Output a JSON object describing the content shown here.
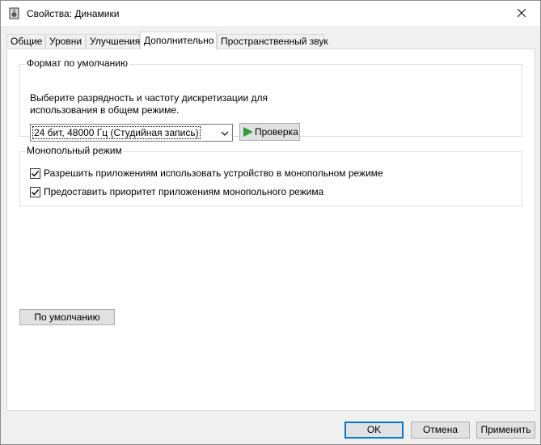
{
  "window": {
    "title": "Свойства: Динамики"
  },
  "tabs": [
    {
      "label": "Общие"
    },
    {
      "label": "Уровни"
    },
    {
      "label": "Улучшения"
    },
    {
      "label": "Дополнительно"
    },
    {
      "label": "Пространственный звук"
    }
  ],
  "active_tab": "Дополнительно",
  "default_format": {
    "title": "Формат по умолчанию",
    "description": "Выберите разрядность и частоту дискретизации для использования в общем режиме.",
    "selected_format": "24 бит, 48000 Гц (Студийная запись)",
    "test_button": "Проверка"
  },
  "exclusive_mode": {
    "title": "Монопольный режим",
    "options": [
      {
        "label": "Разрешить приложениям использовать устройство в монопольном режиме",
        "checked": true
      },
      {
        "label": "Предоставить приоритет приложениям монопольного режима",
        "checked": true
      }
    ]
  },
  "restore_defaults_button": "По умолчанию",
  "buttons": {
    "ok": "OK",
    "cancel": "Отмена",
    "apply": "Применить"
  },
  "colors": {
    "accent": "#0078d7",
    "play_green": "#2e9e33"
  }
}
